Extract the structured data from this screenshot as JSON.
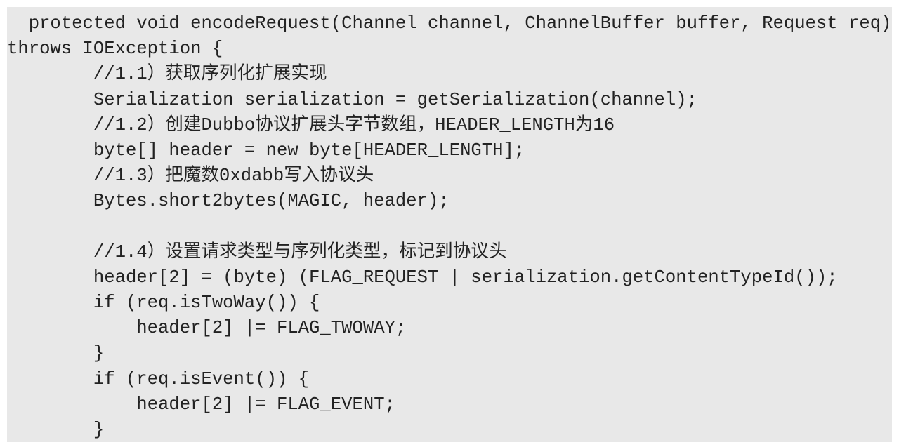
{
  "code_lines": [
    "  protected void encodeRequest(Channel channel, ChannelBuffer buffer, Request req)",
    "throws IOException {",
    "        //1.1）获取序列化扩展实现",
    "        Serialization serialization = getSerialization(channel);",
    "        //1.2）创建Dubbo协议扩展头字节数组，HEADER_LENGTH为16",
    "        byte[] header = new byte[HEADER_LENGTH];",
    "        //1.3）把魔数0xdabb写入协议头",
    "        Bytes.short2bytes(MAGIC, header);",
    "",
    "        //1.4）设置请求类型与序列化类型，标记到协议头",
    "        header[2] = (byte) (FLAG_REQUEST | serialization.getContentTypeId());",
    "        if (req.isTwoWay()) {",
    "            header[2] |= FLAG_TWOWAY;",
    "        }",
    "        if (req.isEvent()) {",
    "            header[2] |= FLAG_EVENT;",
    "        }"
  ]
}
